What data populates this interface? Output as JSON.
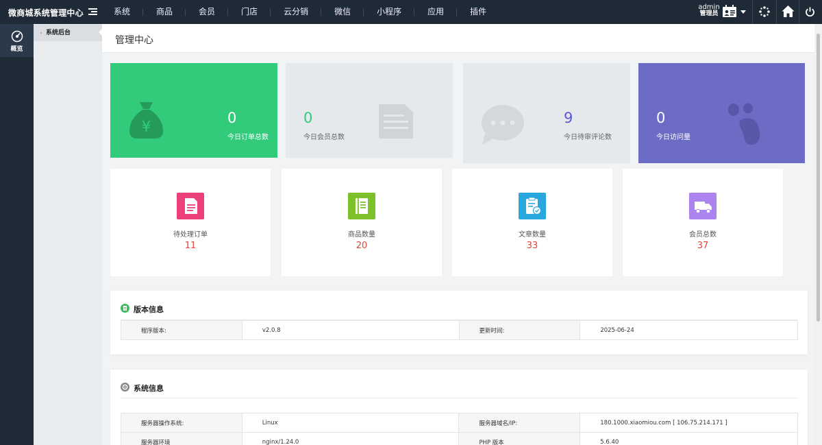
{
  "app": {
    "title": "微商城系统管理中心"
  },
  "nav": [
    "系统",
    "商品",
    "会员",
    "门店",
    "云分销",
    "微信",
    "小程序",
    "应用",
    "插件"
  ],
  "user": {
    "name": "admin",
    "role": "管理员"
  },
  "leftbar": {
    "items": [
      {
        "label": "概览",
        "icon": "dashboard-icon"
      }
    ]
  },
  "subbar": {
    "items": [
      {
        "label": "系统后台"
      }
    ]
  },
  "page": {
    "title": "管理中心"
  },
  "stats": [
    {
      "value": "0",
      "label": "今日订单总数",
      "color": "#31cb7b",
      "icon": "money-bag-icon"
    },
    {
      "value": "0",
      "label": "今日会员总数",
      "color": "#e6e9ec",
      "icon": "document-icon"
    },
    {
      "value": "9",
      "label": "今日待审评论数",
      "color": "#e6e9ec",
      "icon": "chat-bubble-icon"
    },
    {
      "value": "0",
      "label": "今日访问量",
      "color": "#6c6cc4",
      "icon": "paw-icon"
    }
  ],
  "cards": [
    {
      "label": "待处理订单",
      "value": "11",
      "color": "#ec407a",
      "icon": "order-doc-icon"
    },
    {
      "label": "商品数量",
      "value": "20",
      "color": "#7cc12a",
      "icon": "notebook-icon"
    },
    {
      "label": "文章数量",
      "value": "33",
      "color": "#29a8e0",
      "icon": "clipboard-check-icon"
    },
    {
      "label": "会员总数",
      "value": "37",
      "color": "#ac84f0",
      "icon": "truck-icon"
    }
  ],
  "version": {
    "title": "版本信息",
    "rows": [
      {
        "k1": "程序版本:",
        "v1": "v2.0.8",
        "k2": "更新时间:",
        "v2": "2025-06-24"
      }
    ]
  },
  "system": {
    "title": "系统信息",
    "rows": [
      {
        "k1": "服务器操作系统:",
        "v1": "Linux",
        "k2": "服务器域名/IP:",
        "v2": "180.1000.xiaomiou.com [ 106.75.214.171 ]"
      },
      {
        "k1": "服务器环境",
        "v1": "nginx/1.24.0",
        "k2": "PHP 版本",
        "v2": "5.6.40"
      }
    ]
  }
}
